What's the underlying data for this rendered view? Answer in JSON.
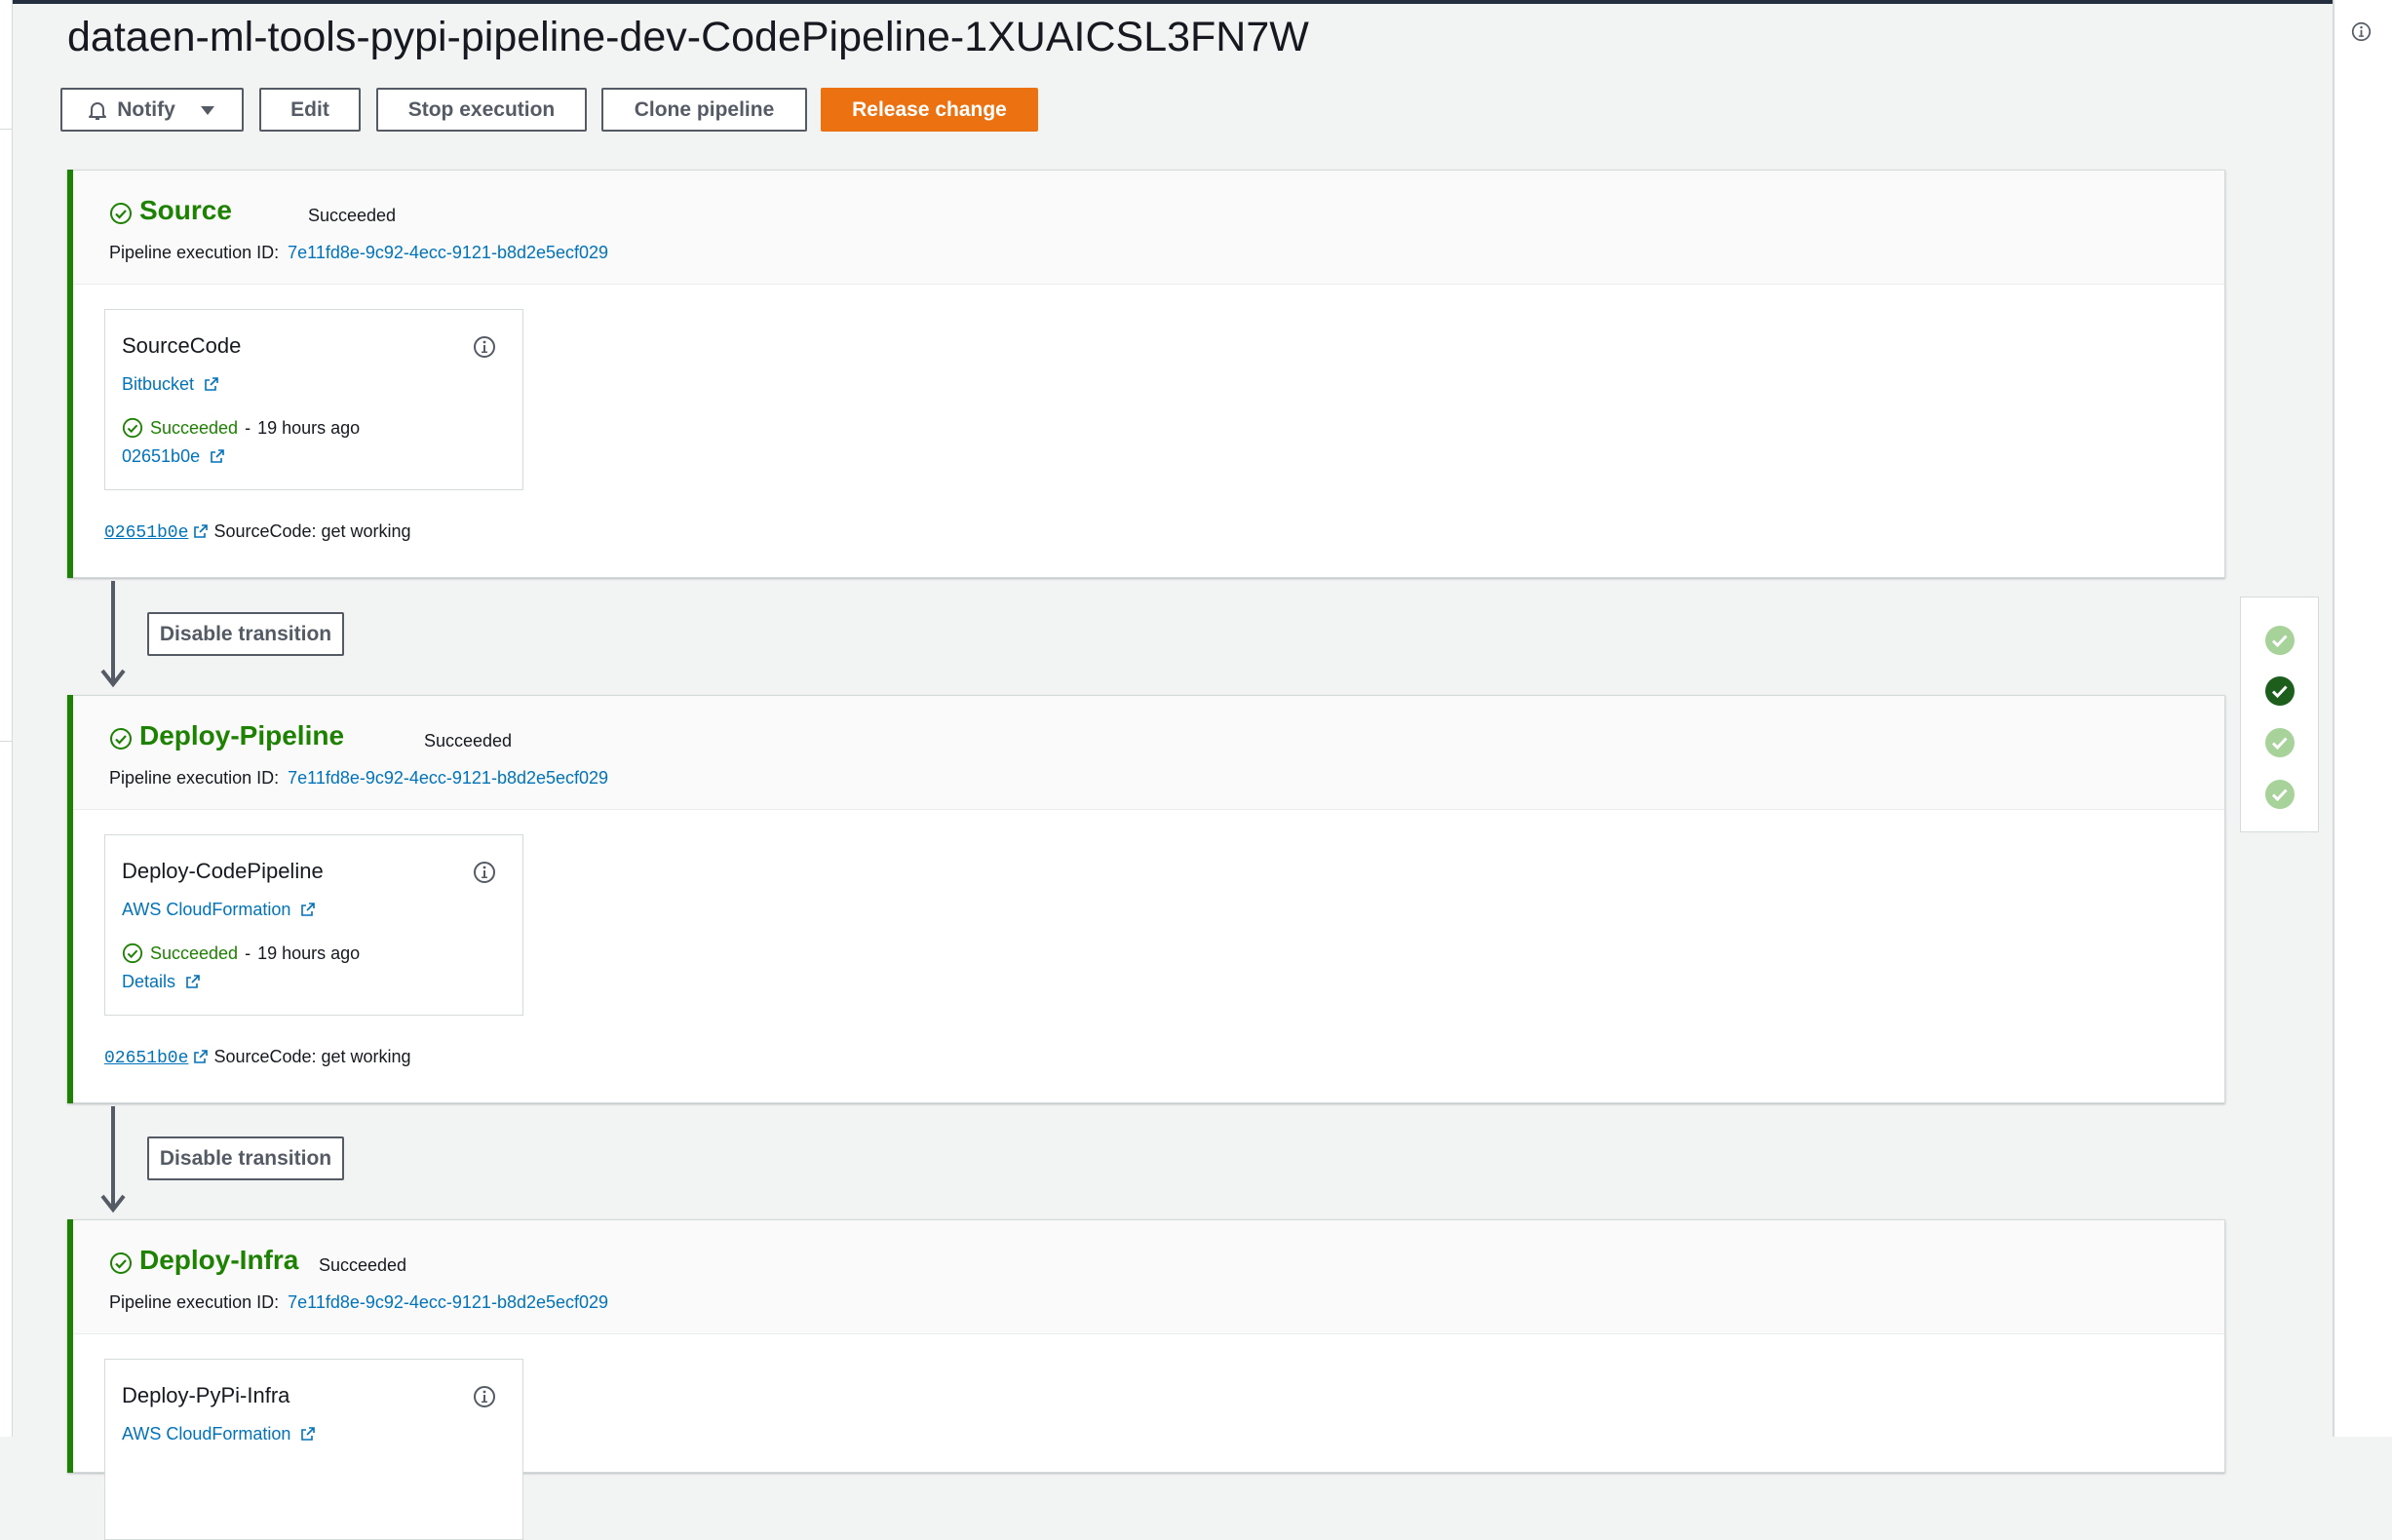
{
  "page": {
    "title": "dataen-ml-tools-pypi-pipeline-dev-CodePipeline-1XUAICSL3FN7W"
  },
  "toolbar": {
    "notify_label": "Notify",
    "edit_label": "Edit",
    "stop_label": "Stop execution",
    "clone_label": "Clone pipeline",
    "release_label": "Release change"
  },
  "colors": {
    "success": "#1d8102",
    "primary": "#ec7211",
    "link": "#0073bb"
  },
  "transition": {
    "disable_label": "Disable transition"
  },
  "stages": [
    {
      "name": "Source",
      "status": "Succeeded",
      "exec_label": "Pipeline execution ID:",
      "exec_id": "7e11fd8e-9c92-4ecc-9121-b8d2e5ecf029",
      "action": {
        "name": "SourceCode",
        "provider": "Bitbucket",
        "status": "Succeeded",
        "time": "19 hours ago",
        "link": "02651b0e"
      },
      "revision": {
        "id": "02651b0e",
        "message": "SourceCode: get working"
      }
    },
    {
      "name": "Deploy-Pipeline",
      "status": "Succeeded",
      "exec_label": "Pipeline execution ID:",
      "exec_id": "7e11fd8e-9c92-4ecc-9121-b8d2e5ecf029",
      "action": {
        "name": "Deploy-CodePipeline",
        "provider": "AWS CloudFormation",
        "status": "Succeeded",
        "time": "19 hours ago",
        "link": "Details"
      },
      "revision": {
        "id": "02651b0e",
        "message": "SourceCode: get working"
      }
    },
    {
      "name": "Deploy-Infra",
      "status": "Succeeded",
      "exec_label": "Pipeline execution ID:",
      "exec_id": "7e11fd8e-9c92-4ecc-9121-b8d2e5ecf029",
      "action": {
        "name": "Deploy-PyPi-Infra",
        "provider": "AWS CloudFormation"
      }
    }
  ]
}
